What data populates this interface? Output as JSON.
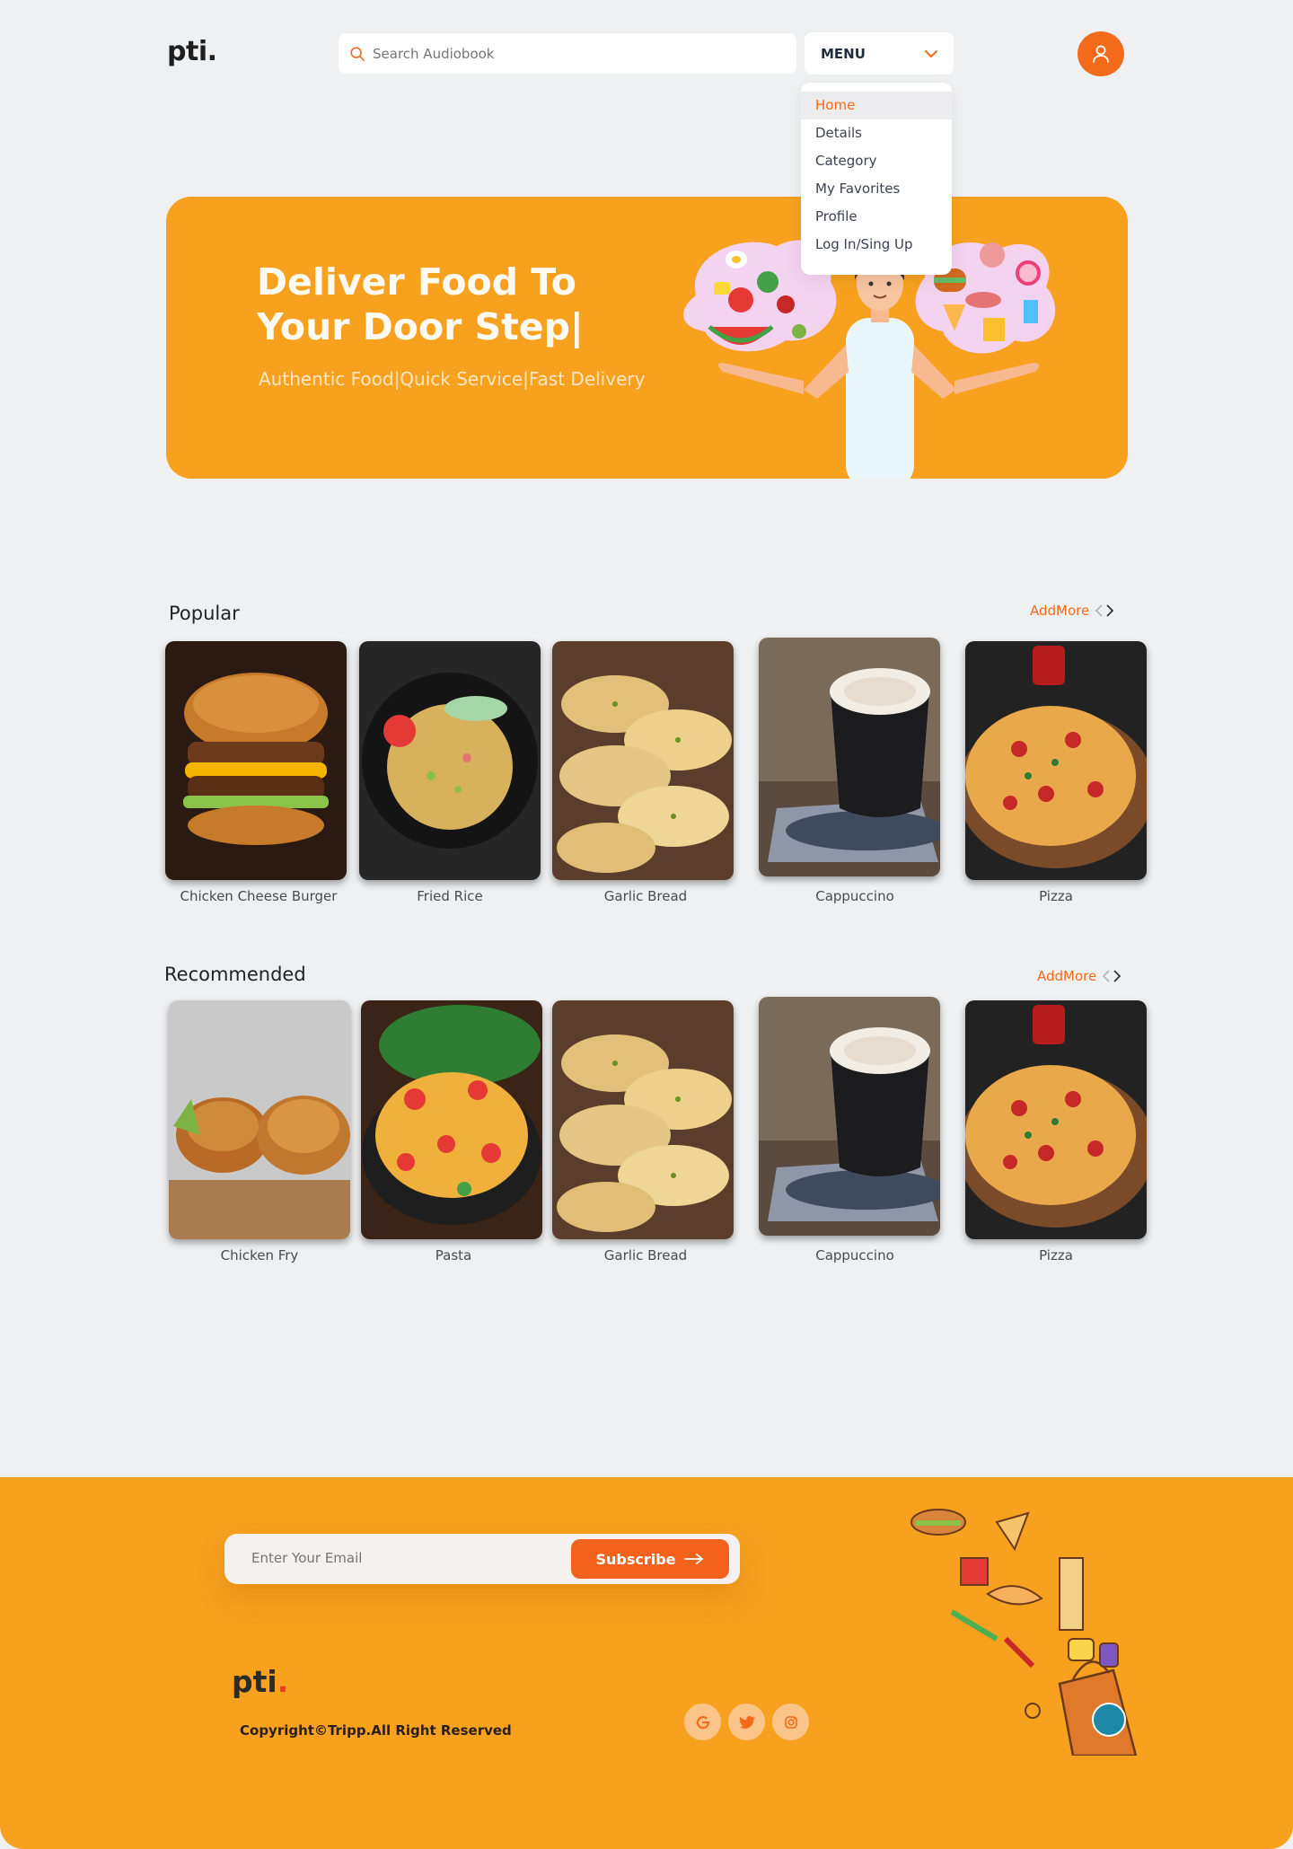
{
  "header": {
    "logo": "pti.",
    "search_placeholder": "Search Audiobook",
    "menu_label": "MENU"
  },
  "dropdown": {
    "items": [
      "Home",
      "Details",
      "Category",
      "My Favorites",
      "Profile",
      "Log In/Sing Up"
    ],
    "active": "Home"
  },
  "hero": {
    "title": "Deliver Food To Your Door Step|",
    "subtitle": "Authentic Food|Quick Service|Fast Delivery"
  },
  "popular": {
    "title": "Popular",
    "addmore": "AddMore",
    "items": [
      "Chicken Cheese Burger",
      "Fried Rice",
      "Garlic Bread",
      "Cappuccino",
      "Pizza"
    ]
  },
  "recommended": {
    "title": "Recommended",
    "addmore": "AddMore",
    "items": [
      "Chicken Fry",
      "Pasta",
      "Garlic Bread",
      "Cappuccino",
      "Pizza"
    ]
  },
  "footer": {
    "email_placeholder": "Enter Your Email",
    "subscribe_label": "Subscribe",
    "logo": "pti",
    "logo_dot": ".",
    "copyright": "Copyright©Tripp.All Right Reserved"
  },
  "colors": {
    "brand_orange": "#f7a11f",
    "accent": "#f46a1b",
    "background": "#eff0f2"
  }
}
